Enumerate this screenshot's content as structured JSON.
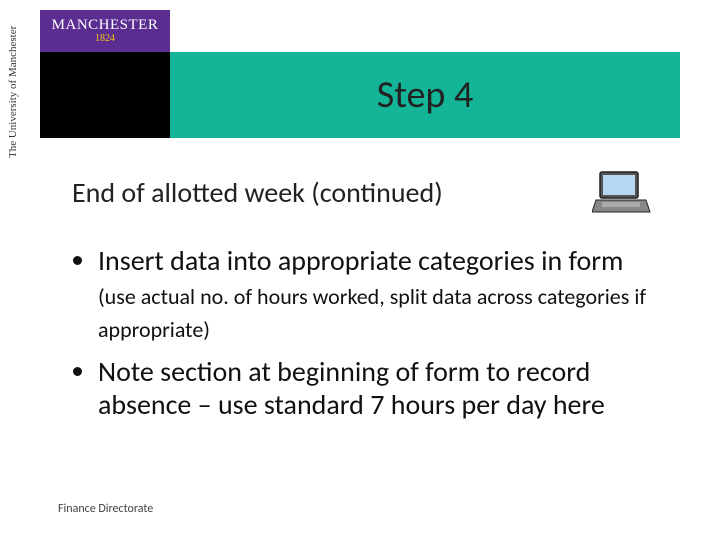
{
  "logo": {
    "line1": "MANCHESTER",
    "line2": "1824",
    "sidetext": "The University of Manchester"
  },
  "header": {
    "title": "Step 4"
  },
  "content": {
    "subheading": "End of allotted week (continued)",
    "bullets": [
      {
        "lead": "Insert data into appropriate categories in form ",
        "paren": "(use actual no. of hours worked, split data across categories if appropriate)"
      },
      {
        "lead": "Note section at beginning of form to record absence – use standard 7 hours per day here",
        "paren": ""
      }
    ]
  },
  "footer": {
    "text": "Finance Directorate"
  },
  "icons": {
    "laptop": "laptop-icon"
  }
}
